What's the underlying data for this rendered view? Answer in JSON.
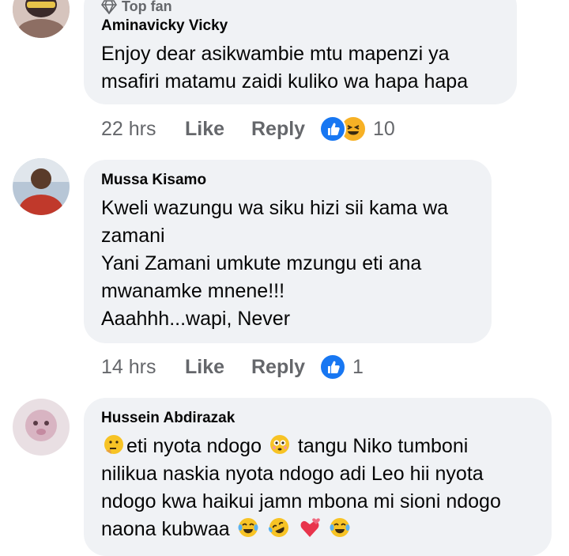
{
  "comments": [
    {
      "badge": "Top fan",
      "name": "Aminavicky Vicky",
      "lines": [
        "Enjoy dear asikwambie mtu mapenzi ya",
        "msafiri matamu zaidi kuliko wa hapa hapa"
      ],
      "time": "22 hrs",
      "like_label": "Like",
      "reply_label": "Reply",
      "reaction_count": "10",
      "reactions": [
        "like-icon",
        "haha-icon"
      ]
    },
    {
      "name": "Mussa Kisamo",
      "lines": [
        "Kweli wazungu wa siku hizi sii kama wa",
        "zamani",
        "Yani Zamani umkute mzungu eti ana",
        "mwanamke mnene!!!",
        "Aaahhh...wapi, Never"
      ],
      "time": "14 hrs",
      "like_label": "Like",
      "reply_label": "Reply",
      "reaction_count": "1",
      "reactions": [
        "like-icon"
      ]
    },
    {
      "name": "Hussein Abdirazak",
      "line1_a": "eti nyota ndogo",
      "line1_b": "tangu Niko tumboni",
      "line2": "nilikua naskia nyota ndogo adi Leo hii nyota",
      "line3": "ndogo kwa haikui jamn mbona mi sioni ndogo",
      "line4": "naona kubwaa",
      "emojis": [
        "thinking-face-emoji",
        "flushed-face-emoji",
        "tears-of-joy-emoji",
        "rolling-laughing-emoji",
        "two-hearts-emoji",
        "tears-of-joy-emoji"
      ]
    }
  ],
  "colors": {
    "bubble": "#f0f2f5",
    "meta": "#65676b",
    "like_blue": "#1877f2",
    "haha_yellow": "#f7b125"
  }
}
